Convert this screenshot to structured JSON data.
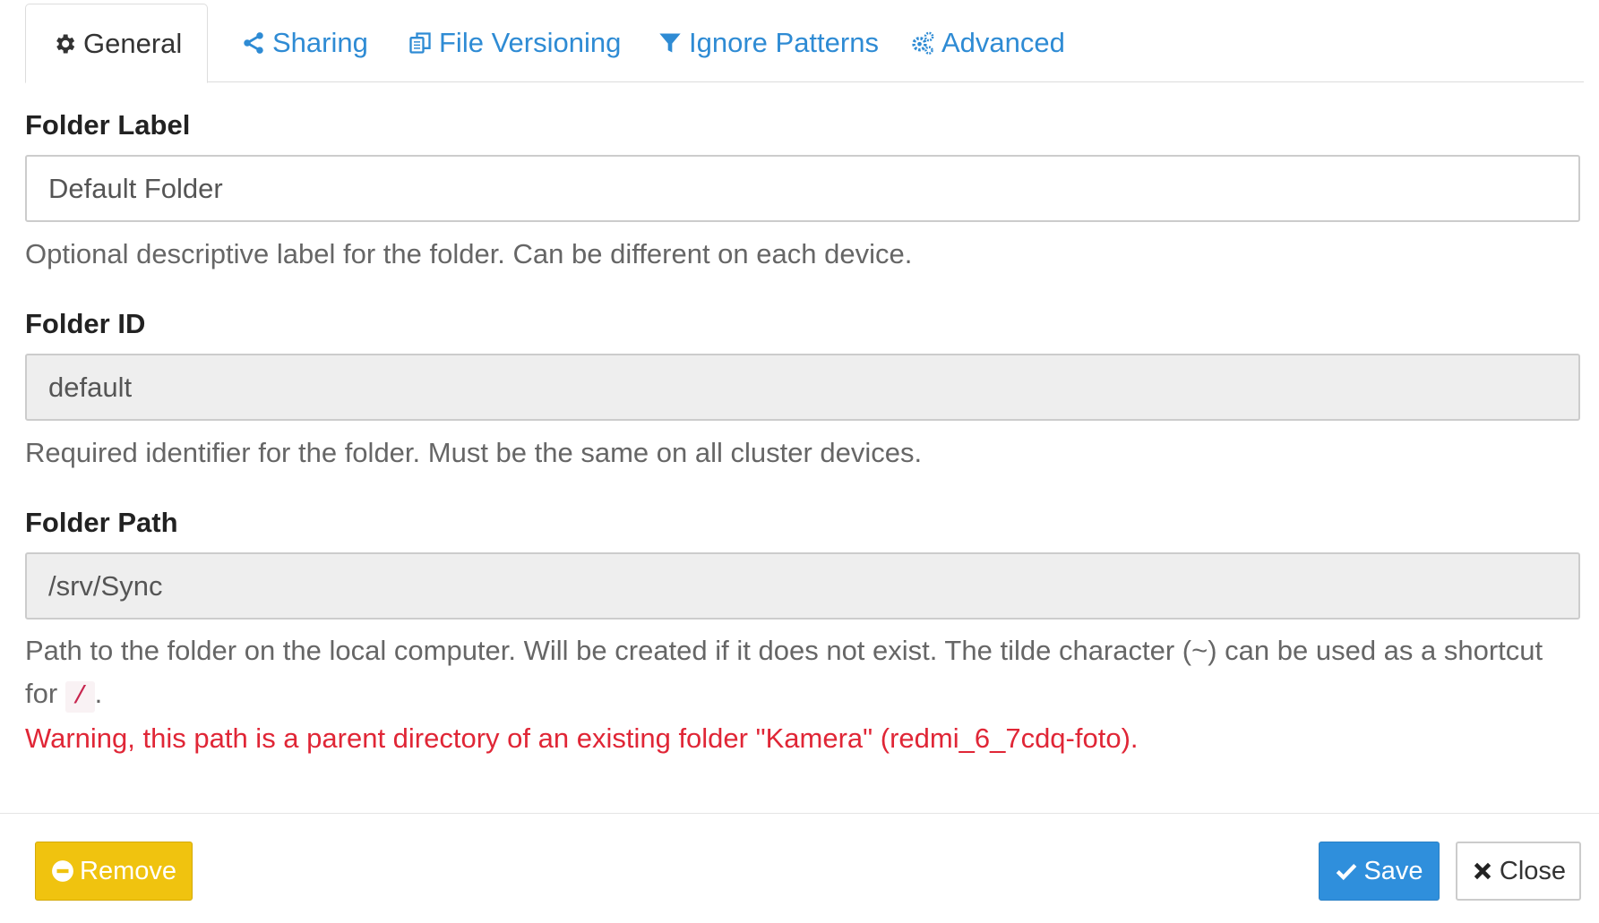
{
  "tabs": [
    {
      "label": "General",
      "icon": "gear-icon",
      "active": true
    },
    {
      "label": "Sharing",
      "icon": "share-icon",
      "active": false
    },
    {
      "label": "File Versioning",
      "icon": "copy-icon",
      "active": false
    },
    {
      "label": "Ignore Patterns",
      "icon": "filter-icon",
      "active": false
    },
    {
      "label": "Advanced",
      "icon": "cogs-icon",
      "active": false
    }
  ],
  "folder_label": {
    "label": "Folder Label",
    "value": "Default Folder",
    "help": "Optional descriptive label for the folder. Can be different on each device."
  },
  "folder_id": {
    "label": "Folder ID",
    "value": "default",
    "help": "Required identifier for the folder. Must be the same on all cluster devices."
  },
  "folder_path": {
    "label": "Folder Path",
    "value": "/srv/Sync",
    "help_main": "Path to the folder on the local computer. Will be created if it does not exist. The tilde character (~) can be used as a shortcut for",
    "help_code": "/",
    "help_end": ".",
    "warning": "Warning, this path is a parent directory of an existing folder \"Kamera\" (redmi_6_7cdq-foto)."
  },
  "buttons": {
    "remove": "Remove",
    "save": "Save",
    "close": "Close"
  },
  "colors": {
    "link": "#2e8bd4",
    "warning": "#e02636",
    "remove_button": "#f0c30f",
    "save_button": "#2f8fdc"
  }
}
